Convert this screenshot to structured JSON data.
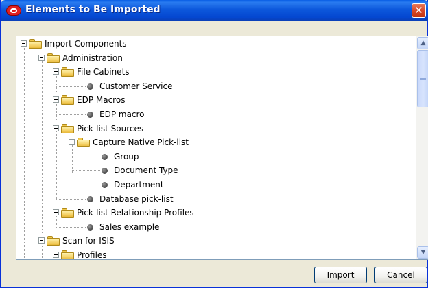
{
  "window": {
    "title": "Elements to Be Imported",
    "close_symbol": "✕"
  },
  "tree": {
    "items": [
      {
        "label": "Import Components",
        "type": "folder",
        "level": 0,
        "expanded": true
      },
      {
        "label": "Administration",
        "type": "folder",
        "level": 1,
        "expanded": true
      },
      {
        "label": "File Cabinets",
        "type": "folder",
        "level": 2,
        "expanded": true
      },
      {
        "label": "Customer Service",
        "type": "leaf",
        "level": 3
      },
      {
        "label": "EDP Macros",
        "type": "folder",
        "level": 2,
        "expanded": true
      },
      {
        "label": "EDP macro",
        "type": "leaf",
        "level": 3
      },
      {
        "label": "Pick-list Sources",
        "type": "folder",
        "level": 2,
        "expanded": true
      },
      {
        "label": "Capture Native Pick-list",
        "type": "folder",
        "level": 3,
        "expanded": true
      },
      {
        "label": "Group",
        "type": "leaf",
        "level": 4
      },
      {
        "label": "Document Type",
        "type": "leaf",
        "level": 4
      },
      {
        "label": "Department",
        "type": "leaf",
        "level": 4
      },
      {
        "label": "Database pick-list",
        "type": "leaf",
        "level": 3
      },
      {
        "label": "Pick-list Relationship Profiles",
        "type": "folder",
        "level": 2,
        "expanded": true
      },
      {
        "label": "Sales example",
        "type": "leaf",
        "level": 3
      },
      {
        "label": "Scan for ISIS",
        "type": "folder",
        "level": 1,
        "expanded": true
      },
      {
        "label": "Profiles",
        "type": "folder",
        "level": 2,
        "expanded": true
      }
    ]
  },
  "scrollbar": {
    "up_symbol": "▲",
    "down_symbol": "▼"
  },
  "buttons": {
    "import_label": "Import",
    "cancel_label": "Cancel"
  }
}
